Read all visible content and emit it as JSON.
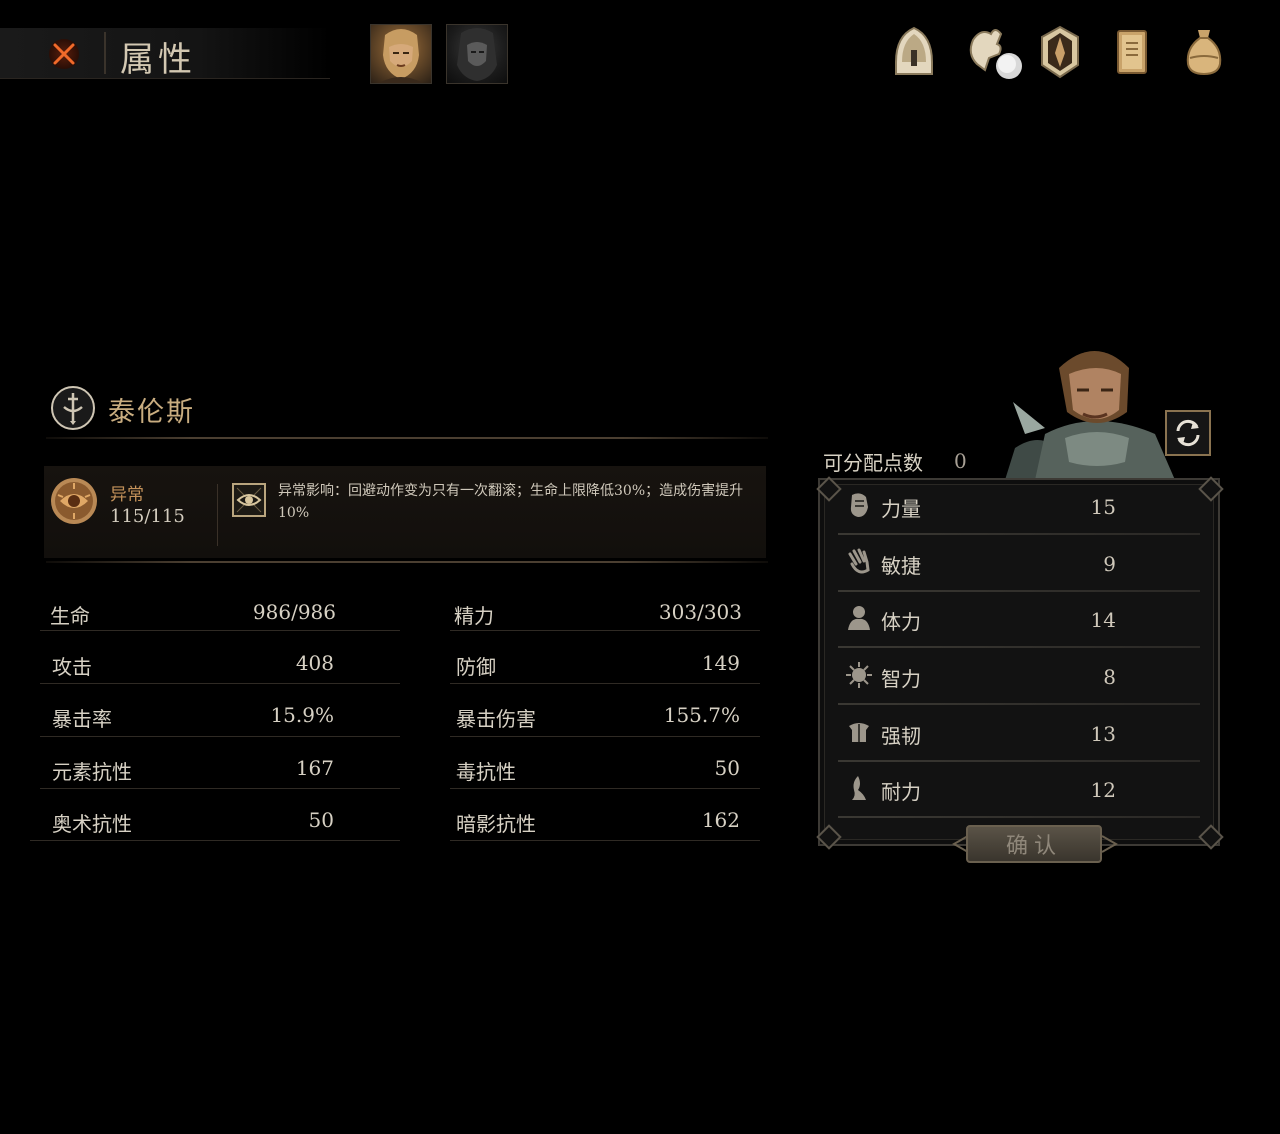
{
  "header": {
    "title": "属性"
  },
  "party": [
    {
      "name": "portrait-taylons"
    },
    {
      "name": "portrait-companion"
    }
  ],
  "menu_icons": [
    "helmet-icon",
    "skill-tree-icon",
    "emblem-icon",
    "journal-icon",
    "bag-icon"
  ],
  "character": {
    "name": "泰伦斯",
    "status": {
      "name": "异常",
      "value": "115/115",
      "effect": "异常影响：回避动作变为只有一次翻滚；生命上限降低30%；造成伤害提升10%"
    },
    "stats": [
      {
        "label": "生命",
        "value": "986/986"
      },
      {
        "label": "精力",
        "value": "303/303"
      },
      {
        "label": "攻击",
        "value": "408"
      },
      {
        "label": "防御",
        "value": "149"
      },
      {
        "label": "暴击率",
        "value": "15.9%"
      },
      {
        "label": "暴击伤害",
        "value": "155.7%"
      },
      {
        "label": "元素抗性",
        "value": "167"
      },
      {
        "label": "毒抗性",
        "value": "50"
      },
      {
        "label": "奥术抗性",
        "value": "50"
      },
      {
        "label": "暗影抗性",
        "value": "162"
      }
    ]
  },
  "attributes": {
    "points_label": "可分配点数",
    "points_value": "0",
    "items": [
      {
        "name": "力量",
        "value": "15"
      },
      {
        "name": "敏捷",
        "value": "9"
      },
      {
        "name": "体力",
        "value": "14"
      },
      {
        "name": "智力",
        "value": "8"
      },
      {
        "name": "强韧",
        "value": "13"
      },
      {
        "name": "耐力",
        "value": "12"
      }
    ],
    "confirm_label": "确认"
  },
  "colors": {
    "background": "#000000",
    "accent_gold": "#c9ad80",
    "status_orange": "#c4925a",
    "close_red": "#e0561e"
  }
}
